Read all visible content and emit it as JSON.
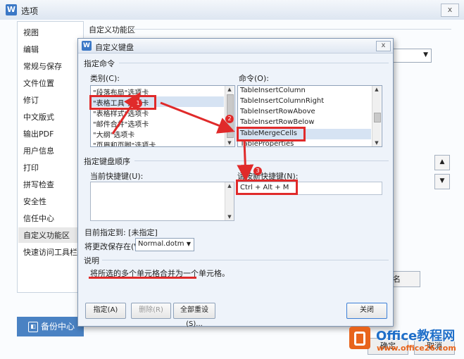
{
  "outer_window": {
    "logo": "W",
    "title": "选项",
    "close_glyph": "x",
    "sidebar": {
      "items": [
        "视图",
        "编辑",
        "常规与保存",
        "文件位置",
        "修订",
        "中文版式",
        "输出PDF",
        "用户信息",
        "打印",
        "拼写检查",
        "安全性",
        "信任中心",
        "自定义功能区",
        "快速访问工具栏"
      ],
      "selected": "自定义功能区"
    },
    "backup_button": "备份中心",
    "section_title": "自定义功能区",
    "rename_partial": "名(M)...",
    "move_up_glyph": "▲",
    "move_down_glyph": "▼",
    "ok_label": "确定",
    "cancel_label": "取消"
  },
  "dialog": {
    "logo": "W",
    "title": "自定义键盘",
    "close_glyph": "x",
    "specify_command_title": "指定命令",
    "categories_label": "类别(C):",
    "categories": [
      "\"段落布局\"选项卡",
      "\"表格工具\"选项卡",
      "\"表格样式\"选项卡",
      "\"邮件合并\"选项卡",
      "\"大纲\"选项卡",
      "\"页眉和页脚\"选项卡"
    ],
    "commands_label": "命令(O):",
    "commands": [
      "TableInsertColumn",
      "TableInsertColumnRight",
      "TableInsertRowAbove",
      "TableInsertRowBelow",
      "TableMergeCells",
      "TableProperties"
    ],
    "key_sequence_title": "指定键盘顺序",
    "current_keys_label": "当前快捷键(U):",
    "new_key_label": "请按新快捷键(N):",
    "new_key_value": "Ctrl + Alt + M",
    "currently_assigned_label": "目前指定到:",
    "currently_assigned_value": "[未指定]",
    "save_changes_label": "将更改保存在(V):",
    "save_changes_value": "Normal.dotm",
    "description_title": "说明",
    "description_text": "将所选的多个单元格合并为一个单元格。",
    "assign_button": "指定(A)",
    "remove_button": "删除(R)",
    "reset_all_button": "全部重设(S)...",
    "close_button": "关闭"
  },
  "annotations": {
    "step1": "1",
    "step2": "2",
    "step3": "3",
    "color": "#e02a2a"
  },
  "watermark": {
    "brand": "Office教程网",
    "url": "www.office26.com"
  }
}
